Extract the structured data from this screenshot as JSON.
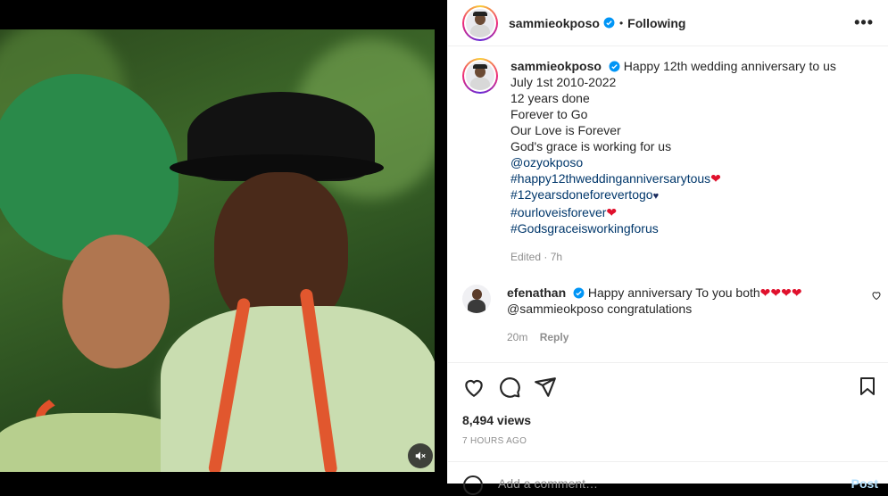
{
  "post": {
    "username": "sammieokposo",
    "follow_status": "Following",
    "more_label": "•••"
  },
  "caption": {
    "username": "sammieokposo",
    "lines": [
      "Happy 12th wedding anniversary to us",
      "July 1st 2010-2022",
      "12 years done",
      "Forever to Go",
      "Our Love is Forever",
      "God's grace is working for us"
    ],
    "mention": "@ozyokposo",
    "tags": [
      "#happy12thweddinganniversarytous",
      "#12yearsdoneforevertogo",
      "#ourloveisforever",
      "#Godsgraceisworkingforus"
    ],
    "edited": "Edited · 7h"
  },
  "comment": {
    "username": "efenathan",
    "text": "Happy anniversary To you both",
    "hearts": "❤❤❤❤",
    "line2": "@sammieokposo congratulations",
    "time": "20m",
    "reply": "Reply"
  },
  "stats": {
    "views": "8,494 views",
    "time_ago": "7 HOURS AGO"
  },
  "add_comment": {
    "placeholder": "Add a comment…",
    "post_label": "Post"
  }
}
